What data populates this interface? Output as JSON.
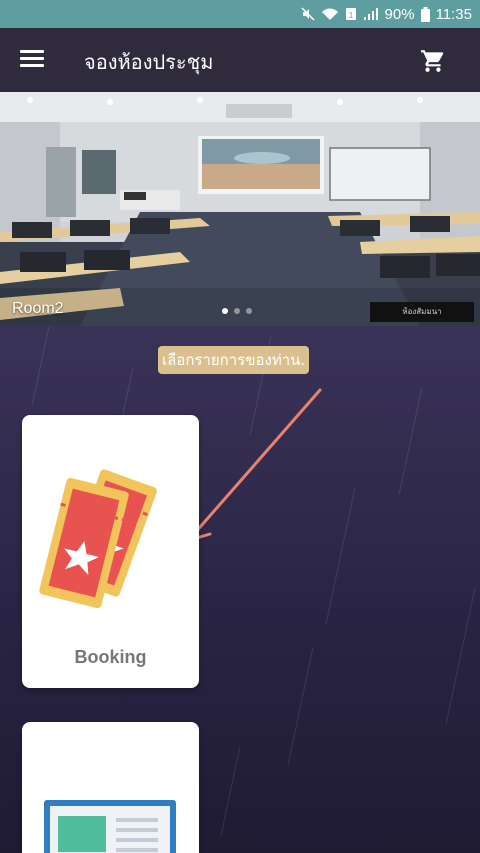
{
  "status_bar": {
    "battery_percent": "90%",
    "time": "11:35",
    "icons": [
      "mute-icon",
      "wifi-icon",
      "sim-icon",
      "signal-icon",
      "battery-icon"
    ]
  },
  "app_bar": {
    "title": "จองห้องประชุม",
    "menu_icon": "hamburger-icon",
    "cart_icon": "cart-icon"
  },
  "banner": {
    "caption": "Room2",
    "slide_count": 3,
    "active_slide": 0,
    "corner_label": "ห้องสัมมนา"
  },
  "main": {
    "prompt": "เลือกรายการของท่าน.",
    "cards": [
      {
        "label": "Booking",
        "icon": "ticket-icon"
      },
      {
        "label": "",
        "icon": "document-icon"
      }
    ]
  },
  "colors": {
    "status_bar": "#5f9ea0",
    "app_bar": "#2f2b3d",
    "main_bg": "#2a2444",
    "prompt_bg": "#d9c08e",
    "arrow": "#e8826a",
    "ticket_red": "#e8534f",
    "ticket_yellow": "#f2c55c",
    "doc_blue": "#2f7fc0",
    "doc_green": "#4fbf9b"
  }
}
